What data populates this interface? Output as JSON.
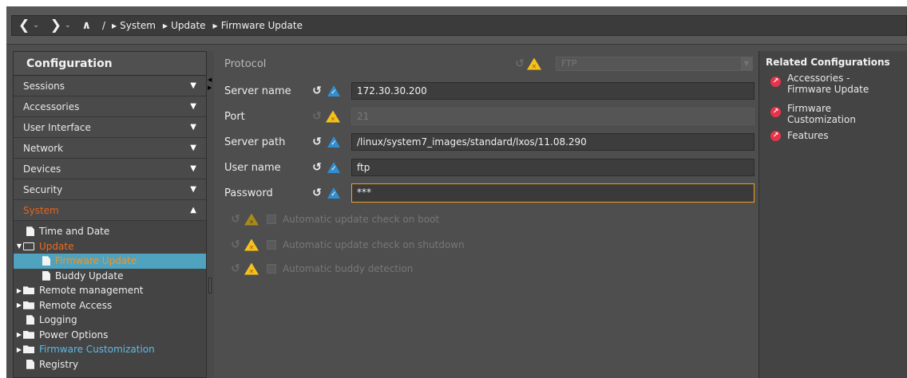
{
  "breadcrumb": {
    "root": "/",
    "items": [
      "System",
      "Update",
      "Firmware Update"
    ]
  },
  "left": {
    "title": "Configuration",
    "categories": [
      {
        "label": "Sessions"
      },
      {
        "label": "Accessories"
      },
      {
        "label": "User Interface"
      },
      {
        "label": "Network"
      },
      {
        "label": "Devices"
      },
      {
        "label": "Security"
      },
      {
        "label": "System"
      }
    ],
    "tree": {
      "time_and_date": "Time and Date",
      "update": "Update",
      "firmware_update": "Firmware Update",
      "buddy_update": "Buddy Update",
      "remote_management": "Remote management",
      "remote_access": "Remote Access",
      "logging": "Logging",
      "power_options": "Power Options",
      "firmware_customization": "Firmware Customization",
      "registry": "Registry"
    }
  },
  "form": {
    "protocol": {
      "label": "Protocol",
      "value": "FTP"
    },
    "server_name": {
      "label": "Server name",
      "value": "172.30.30.200"
    },
    "port": {
      "label": "Port",
      "value": "21"
    },
    "server_path": {
      "label": "Server path",
      "value": "/linux/system7_images/standard/lxos/11.08.290"
    },
    "user_name": {
      "label": "User name",
      "value": "ftp"
    },
    "password": {
      "label": "Password",
      "value": "***"
    },
    "checkboxes": [
      {
        "label": "Automatic update check on boot",
        "checked": false
      },
      {
        "label": "Automatic update check on shutdown",
        "checked": false
      },
      {
        "label": "Automatic buddy detection",
        "checked": false
      }
    ]
  },
  "right": {
    "title": "Related Configurations",
    "links": [
      {
        "line1": "Accessories -",
        "line2": "Firmware Update"
      },
      {
        "line1": "Firmware",
        "line2": "Customization"
      },
      {
        "line1": "Features",
        "line2": ""
      }
    ]
  },
  "colors": {
    "active_category": "#e8631c",
    "selection_bg": "#4fa3bf",
    "ok_icon": "#2f8fd0",
    "warn_icon": "#f5c21b",
    "link_icon": "#e8334a"
  }
}
